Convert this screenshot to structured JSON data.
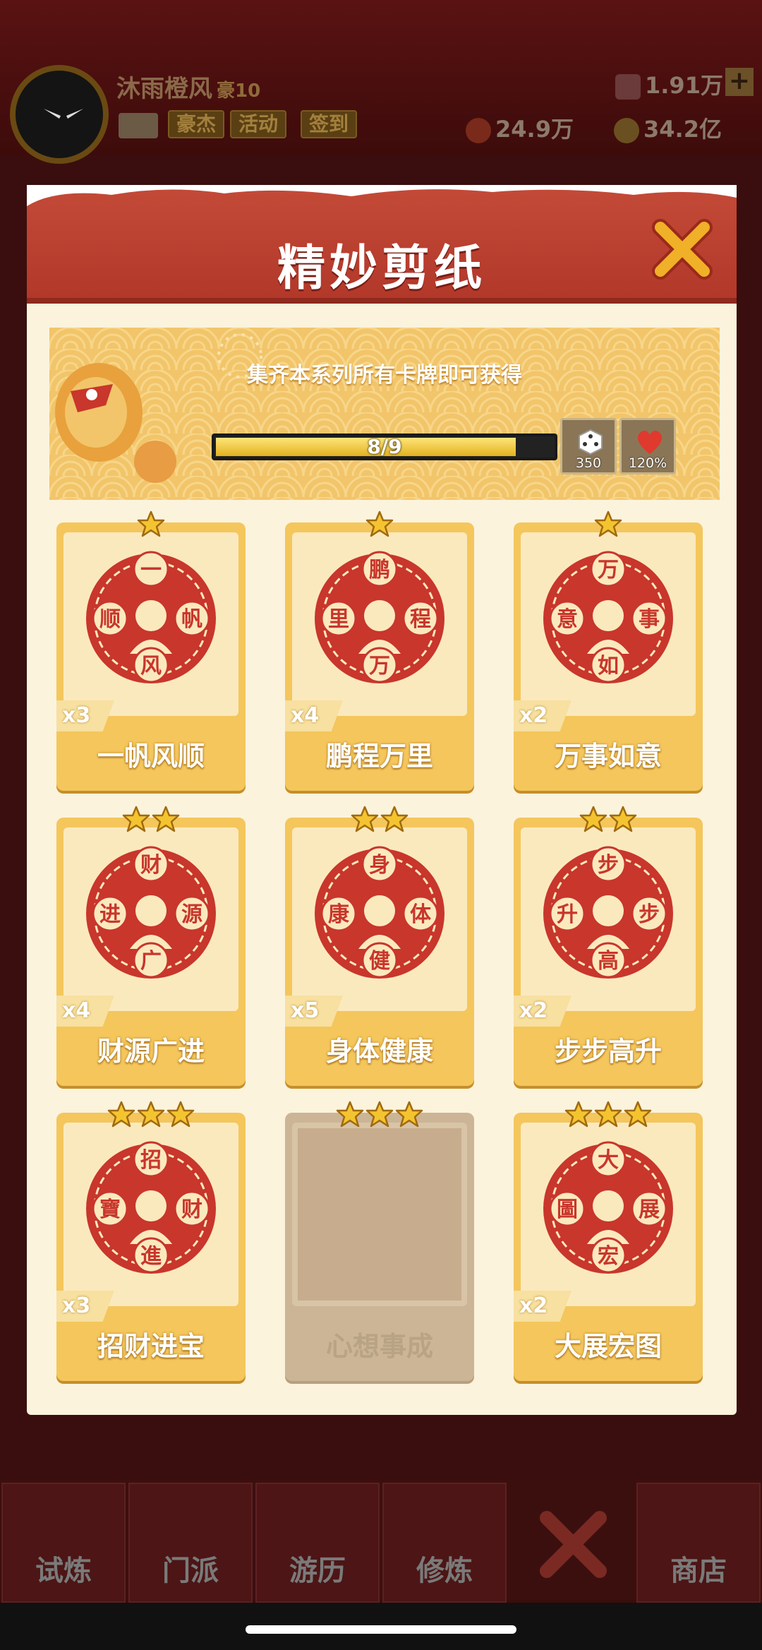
{
  "hud": {
    "player_name": "沐雨橙风",
    "rank": "豪10",
    "buttons": [
      "豪杰",
      "活动",
      "签到"
    ],
    "gems": "1.91万",
    "tokens": "24.9万",
    "gold": "34.2亿"
  },
  "bottom_nav": [
    {
      "label": "试炼"
    },
    {
      "label": "门派"
    },
    {
      "label": "游历"
    },
    {
      "label": "修炼"
    },
    {
      "label": "商店"
    }
  ],
  "modal": {
    "title": "精妙剪纸",
    "banner_text": "集齐本系列所有卡牌即可获得",
    "progress": {
      "text": "8/9",
      "collected": 8,
      "total": 9
    },
    "rewards": [
      {
        "icon": "dice-icon",
        "value": "350"
      },
      {
        "icon": "heart-icon",
        "value": "120%"
      }
    ]
  },
  "cards": [
    {
      "name": "一帆风顺",
      "count": "x3",
      "stars": 1,
      "locked": false,
      "emblem_text": "一帆风顺"
    },
    {
      "name": "鹏程万里",
      "count": "x4",
      "stars": 1,
      "locked": false,
      "emblem_text": "鹏程万里"
    },
    {
      "name": "万事如意",
      "count": "x2",
      "stars": 1,
      "locked": false,
      "emblem_text": "万事如意"
    },
    {
      "name": "财源广进",
      "count": "x4",
      "stars": 2,
      "locked": false,
      "emblem_text": "财源广进"
    },
    {
      "name": "身体健康",
      "count": "x5",
      "stars": 2,
      "locked": false,
      "emblem_text": "身体健康"
    },
    {
      "name": "步步高升",
      "count": "x2",
      "stars": 2,
      "locked": false,
      "emblem_text": "步步高升"
    },
    {
      "name": "招财进宝",
      "count": "x3",
      "stars": 3,
      "locked": false,
      "emblem_text": "招财進寶"
    },
    {
      "name": "心想事成",
      "count": "",
      "stars": 3,
      "locked": true,
      "emblem_text": ""
    },
    {
      "name": "大展宏图",
      "count": "x2",
      "stars": 3,
      "locked": false,
      "emblem_text": "大展宏圖"
    }
  ],
  "colors": {
    "paper_red": "#c8362c",
    "card_gold": "#f4c65c",
    "header_red": "#b9402f",
    "modal_bg": "#fbf3dc"
  }
}
